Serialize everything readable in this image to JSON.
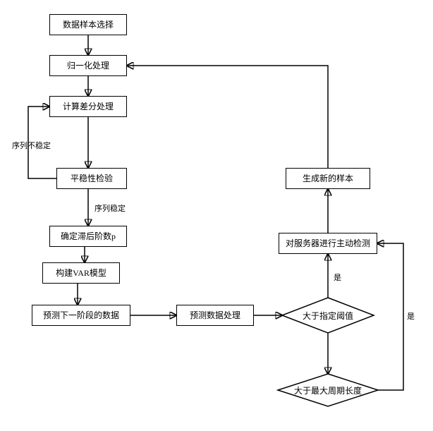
{
  "nodes": {
    "n1": "数据样本选择",
    "n2": "归一化处理",
    "n3": "计算差分处理",
    "n4": "平稳性检验",
    "n5": "确定滞后阶数p",
    "n6": "构建VAR模型",
    "n7": "预测下一阶段的数据",
    "n8": "预测数据处理",
    "n9": "大于指定阈值",
    "n10": "大于最大周期长度",
    "n11": "对服务器进行主动检测",
    "n12": "生成新的样本"
  },
  "labels": {
    "unstable": "序列不稳定",
    "stable": "序列稳定",
    "yes1": "是",
    "yes2": "是"
  },
  "chart_data": {
    "type": "flowchart",
    "nodes": [
      {
        "id": "n1",
        "shape": "rect",
        "label": "数据样本选择"
      },
      {
        "id": "n2",
        "shape": "rect",
        "label": "归一化处理"
      },
      {
        "id": "n3",
        "shape": "rect",
        "label": "计算差分处理"
      },
      {
        "id": "n4",
        "shape": "rect",
        "label": "平稳性检验"
      },
      {
        "id": "n5",
        "shape": "rect",
        "label": "确定滞后阶数p"
      },
      {
        "id": "n6",
        "shape": "rect",
        "label": "构建VAR模型"
      },
      {
        "id": "n7",
        "shape": "rect",
        "label": "预测下一阶段的数据"
      },
      {
        "id": "n8",
        "shape": "rect",
        "label": "预测数据处理"
      },
      {
        "id": "n9",
        "shape": "diamond",
        "label": "大于指定阈值"
      },
      {
        "id": "n10",
        "shape": "diamond",
        "label": "大于最大周期长度"
      },
      {
        "id": "n11",
        "shape": "rect",
        "label": "对服务器进行主动检测"
      },
      {
        "id": "n12",
        "shape": "rect",
        "label": "生成新的样本"
      }
    ],
    "edges": [
      {
        "from": "n1",
        "to": "n2"
      },
      {
        "from": "n2",
        "to": "n3"
      },
      {
        "from": "n3",
        "to": "n4"
      },
      {
        "from": "n4",
        "to": "n3",
        "label": "序列不稳定"
      },
      {
        "from": "n4",
        "to": "n5",
        "label": "序列稳定"
      },
      {
        "from": "n5",
        "to": "n6"
      },
      {
        "from": "n6",
        "to": "n7"
      },
      {
        "from": "n7",
        "to": "n8"
      },
      {
        "from": "n8",
        "to": "n9"
      },
      {
        "from": "n9",
        "to": "n11",
        "label": "是"
      },
      {
        "from": "n9",
        "to": "n10"
      },
      {
        "from": "n10",
        "to": "n11",
        "label": "是"
      },
      {
        "from": "n11",
        "to": "n12"
      },
      {
        "from": "n12",
        "to": "n2"
      }
    ]
  }
}
